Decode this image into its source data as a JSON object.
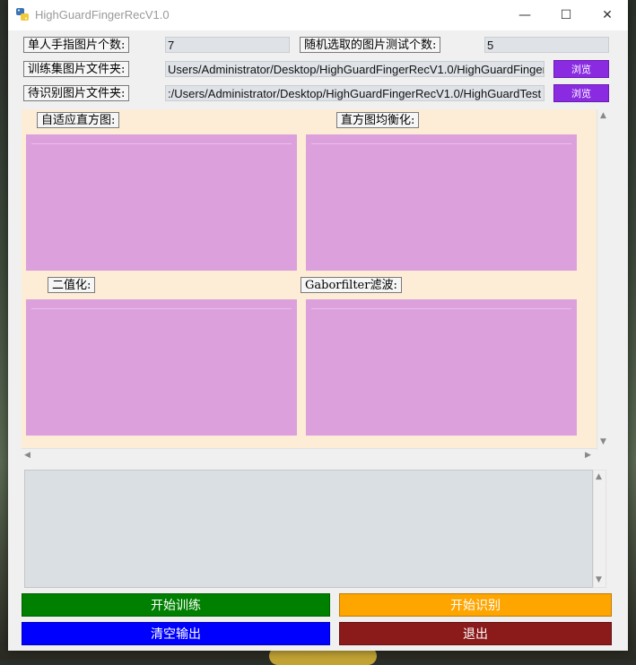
{
  "window": {
    "title": "HighGuardFingerRecV1.0",
    "minimize_glyph": "—",
    "maximize_glyph": "☐",
    "close_glyph": "✕"
  },
  "form": {
    "fingers_label": "单人手指图片个数:",
    "fingers_value": "7",
    "random_label": "随机选取的图片测试个数:",
    "random_value": "5",
    "train_label": "训练集图片文件夹:",
    "train_value": "Users/Administrator/Desktop/HighGuardFingerRecV1.0/HighGuardFinger",
    "test_label": "待识别图片文件夹:",
    "test_value": ":/Users/Administrator/Desktop/HighGuardFingerRecV1.0/HighGuardTest",
    "browse_label": "浏览"
  },
  "panels": {
    "adaptive_hist": "自适应直方图:",
    "hist_eq": "直方图均衡化:",
    "binarize": "二值化:",
    "gabor": "Gaborfilter滤波:"
  },
  "actions": {
    "train": "开始训练",
    "recognize": "开始识别",
    "clear": "清空输出",
    "exit": "退出"
  },
  "colors": {
    "train": "#008000",
    "recognize": "#ffa500",
    "clear": "#0000ff",
    "exit": "#8b1a1a",
    "browse": "#8a2be2",
    "image_placeholder": "#dca0dd",
    "canvas_bg": "#fdedd6"
  },
  "icons": {
    "app": "python-icon",
    "scroll_up": "▲",
    "scroll_down": "▼",
    "scroll_left": "◀",
    "scroll_right": "▶"
  }
}
